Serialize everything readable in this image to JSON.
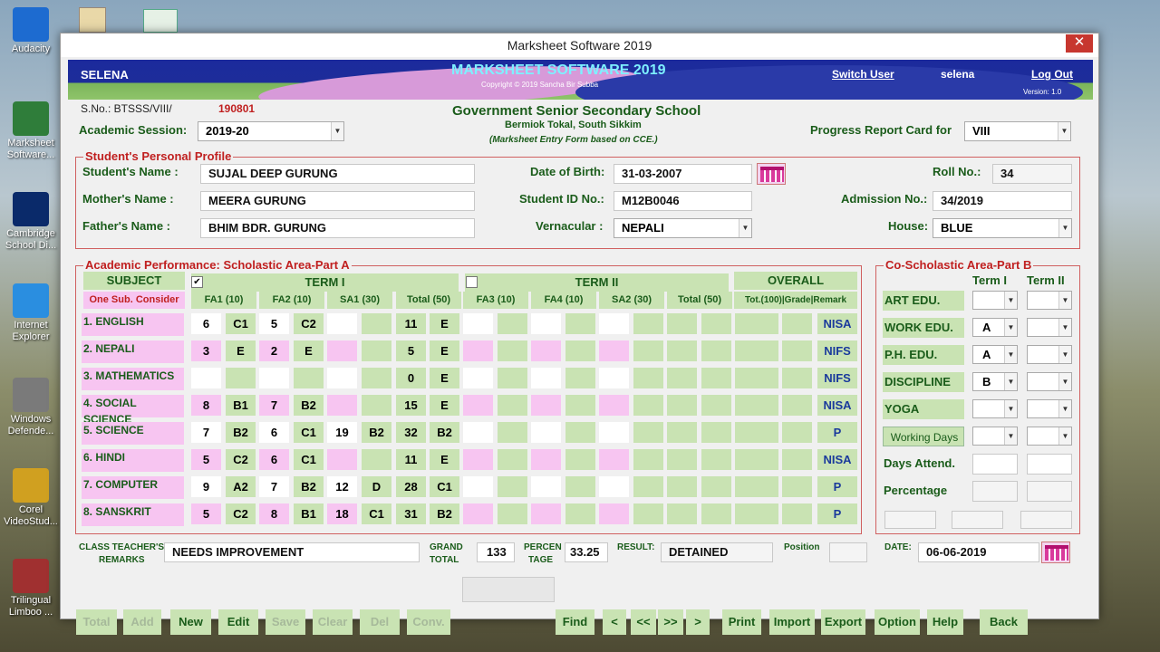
{
  "desktop": {
    "icons": [
      {
        "label": "Audacity",
        "name": "audacity-icon",
        "color": "#1d6bd0"
      },
      {
        "label": "Marksheet Software...",
        "name": "marksheet-software-icon",
        "color": "#2f7d3a"
      },
      {
        "label": "Cambridge School Di...",
        "name": "cambridge-csd-icon",
        "color": "#0a2a6a"
      },
      {
        "label": "Internet Explorer",
        "name": "internet-explorer-icon",
        "color": "#2a8ee0"
      },
      {
        "label": "Windows Defende...",
        "name": "windows-defender-icon",
        "color": "#7a7a7a"
      },
      {
        "label": "Corel VideoStud...",
        "name": "corel-videostudio-icon",
        "color": "#d0a020"
      },
      {
        "label": "Trilingual Limboo ...",
        "name": "trilingual-limboo-icon",
        "color": "#a03030"
      }
    ]
  },
  "window": {
    "title": "Marksheet Software 2019",
    "close": "✕"
  },
  "banner": {
    "user": "SELENA",
    "app_title": "MARKSHEET SOFTWARE 2019",
    "copyright": "Copyright © 2019 Sancha Bir Subba",
    "switch_user": "Switch User",
    "current_user": "selena",
    "logout": "Log Out",
    "version": "Version: 1.0"
  },
  "school": {
    "name": "Government Senior Secondary School",
    "address": "Bermiok Tokal, South Sikkim",
    "note": "(Marksheet Entry Form  based on CCE.)"
  },
  "top": {
    "sno_label": "S.No.: BTSSS/VIII/",
    "sno_value": "190801",
    "session_label": "Academic Session:",
    "session_value": "2019-20",
    "report_label": "Progress Report Card for",
    "report_value": "VIII"
  },
  "profile": {
    "title": "Student's Personal Profile",
    "student_name_label": "Student's Name  :",
    "student_name": "SUJAL DEEP GURUNG",
    "mother_label": "Mother's Name  :",
    "mother": "MEERA GURUNG",
    "father_label": "Father's Name    :",
    "father": "BHIM BDR. GURUNG",
    "dob_label": "Date of Birth:",
    "dob": "31-03-2007",
    "student_id_label": "Student ID No.:",
    "student_id": "M12B0046",
    "vernacular_label": "Vernacular  :",
    "vernacular": "NEPALI",
    "roll_label": "Roll No.:",
    "roll": "34",
    "admission_label": "Admission No.:",
    "admission": "34/2019",
    "house_label": "House:",
    "house": "BLUE"
  },
  "scholastic": {
    "title": "Academic Performance: Scholastic Area-Part A",
    "subject_header": "SUBJECT",
    "one_sub": "One Sub. Consider",
    "term1": "TERM I",
    "term2": "TERM II",
    "overall": "OVERALL",
    "term1_check": "✔",
    "cols": [
      "FA1 (10)",
      "FA2 (10)",
      "SA1 (30)",
      "Total (50)",
      "FA3 (10)",
      "FA4 (10)",
      "SA2 (30)",
      "Total (50)"
    ],
    "overall_cols": "Tot.(100)|Grade|Remark",
    "rows": [
      {
        "subject": "1. ENGLISH",
        "fa1": "6",
        "fa1g": "C1",
        "fa2": "5",
        "fa2g": "C2",
        "sa1": "",
        "sa1g": "",
        "tot": "11",
        "totg": "E",
        "remark": "NISA",
        "pink": false
      },
      {
        "subject": "2. NEPALI",
        "fa1": "3",
        "fa1g": "E",
        "fa2": "2",
        "fa2g": "E",
        "sa1": "",
        "sa1g": "",
        "tot": "5",
        "totg": "E",
        "remark": "NIFS",
        "pink": true
      },
      {
        "subject": "3. MATHEMATICS",
        "fa1": "",
        "fa1g": "",
        "fa2": "",
        "fa2g": "",
        "sa1": "",
        "sa1g": "",
        "tot": "0",
        "totg": "E",
        "remark": "NIFS",
        "pink": false
      },
      {
        "subject": "4. SOCIAL SCIENCE",
        "fa1": "8",
        "fa1g": "B1",
        "fa2": "7",
        "fa2g": "B2",
        "sa1": "",
        "sa1g": "",
        "tot": "15",
        "totg": "E",
        "remark": "NISA",
        "pink": true
      },
      {
        "subject": "5. SCIENCE",
        "fa1": "7",
        "fa1g": "B2",
        "fa2": "6",
        "fa2g": "C1",
        "sa1": "19",
        "sa1g": "B2",
        "tot": "32",
        "totg": "B2",
        "remark": "P",
        "pink": false
      },
      {
        "subject": "6. HINDI",
        "fa1": "5",
        "fa1g": "C2",
        "fa2": "6",
        "fa2g": "C1",
        "sa1": "",
        "sa1g": "",
        "tot": "11",
        "totg": "E",
        "remark": "NISA",
        "pink": true
      },
      {
        "subject": "7. COMPUTER",
        "fa1": "9",
        "fa1g": "A2",
        "fa2": "7",
        "fa2g": "B2",
        "sa1": "12",
        "sa1g": "D",
        "tot": "28",
        "totg": "C1",
        "remark": "P",
        "pink": false
      },
      {
        "subject": "8. SANSKRIT",
        "fa1": "5",
        "fa1g": "C2",
        "fa2": "8",
        "fa2g": "B1",
        "sa1": "18",
        "sa1g": "C1",
        "tot": "31",
        "totg": "B2",
        "remark": "P",
        "pink": true
      }
    ]
  },
  "coscholastic": {
    "title": "Co-Scholastic Area-Part B",
    "term1": "Term I",
    "term2": "Term II",
    "rows": [
      {
        "label": "ART EDU.",
        "t1": "",
        "t2": ""
      },
      {
        "label": "WORK  EDU.",
        "t1": "A",
        "t2": ""
      },
      {
        "label": "P.H. EDU.",
        "t1": "A",
        "t2": ""
      },
      {
        "label": "DISCIPLINE",
        "t1": "B",
        "t2": ""
      },
      {
        "label": "YOGA",
        "t1": "",
        "t2": ""
      },
      {
        "label": "Working Days",
        "t1": "",
        "t2": ""
      }
    ],
    "days_label": "Days Attend.",
    "percentage_label": "Percentage"
  },
  "footer": {
    "remarks_label1": "CLASS TEACHER'S",
    "remarks_label2": "REMARKS",
    "remarks": "NEEDS IMPROVEMENT",
    "grand_label1": "GRAND",
    "grand_label2": "TOTAL",
    "grand": "133",
    "percent_label1": "PERCEN",
    "percent_label2": "TAGE",
    "percent": "33.25",
    "result_label": "RESULT:",
    "result": "DETAINED",
    "position_label": "Position",
    "position": "",
    "date_label": "DATE:",
    "date": "06-06-2019"
  },
  "buttons": {
    "total": "Total",
    "add": "Add",
    "new": "New",
    "edit": "Edit",
    "save": "Save",
    "clear": "Clear",
    "del": "Del",
    "conv": "Conv.",
    "find": "Find",
    "prev": "<",
    "first": "<<",
    "last": ">>",
    "next": ">",
    "print": "Print",
    "import": "Import",
    "export": "Export",
    "option": "Option",
    "help": "Help",
    "back": "Back"
  },
  "colors": {
    "green": "#c9e3b3",
    "pink": "#f7c5f1",
    "label": "#1a5c1a",
    "red": "#c02020",
    "banner": "#1c2a9c"
  }
}
